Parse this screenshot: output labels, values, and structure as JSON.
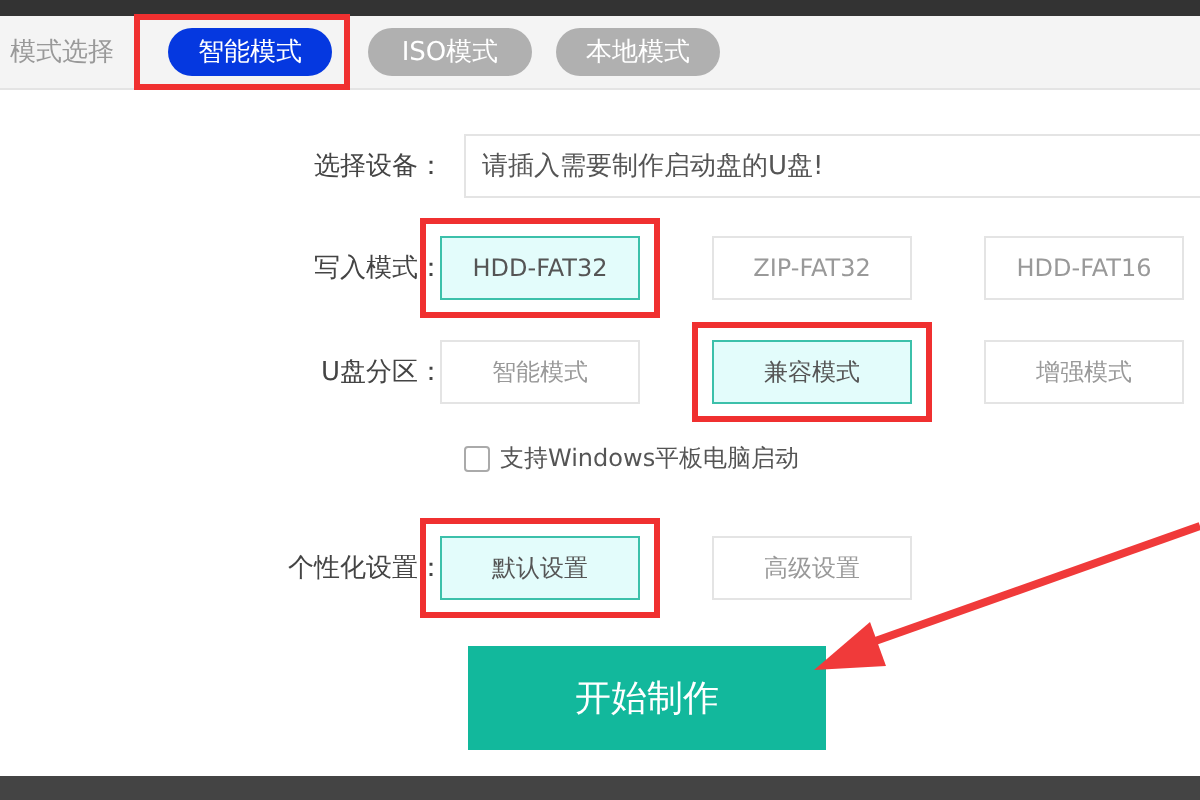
{
  "mode_bar": {
    "label": "模式选择",
    "tabs": [
      {
        "label": "智能模式",
        "selected": true,
        "annotated": true
      },
      {
        "label": "ISO模式",
        "selected": false,
        "annotated": false
      },
      {
        "label": "本地模式",
        "selected": false,
        "annotated": false
      }
    ]
  },
  "device": {
    "label": "选择设备：",
    "value": "请插入需要制作启动盘的U盘!"
  },
  "write_mode": {
    "label": "写入模式：",
    "options": [
      {
        "label": "HDD-FAT32",
        "selected": true,
        "annotated": true
      },
      {
        "label": "ZIP-FAT32",
        "selected": false,
        "annotated": false
      },
      {
        "label": "HDD-FAT16",
        "selected": false,
        "annotated": false
      }
    ]
  },
  "partition": {
    "label": "U盘分区：",
    "options": [
      {
        "label": "智能模式",
        "selected": false,
        "annotated": false
      },
      {
        "label": "兼容模式",
        "selected": true,
        "annotated": true
      },
      {
        "label": "增强模式",
        "selected": false,
        "annotated": false
      }
    ]
  },
  "tablet_boot": {
    "label": "支持Windows平板电脑启动",
    "checked": false
  },
  "personalize": {
    "label": "个性化设置：",
    "options": [
      {
        "label": "默认设置",
        "selected": true,
        "annotated": true
      },
      {
        "label": "高级设置",
        "selected": false,
        "annotated": false
      }
    ]
  },
  "start_button": {
    "label": "开始制作"
  }
}
